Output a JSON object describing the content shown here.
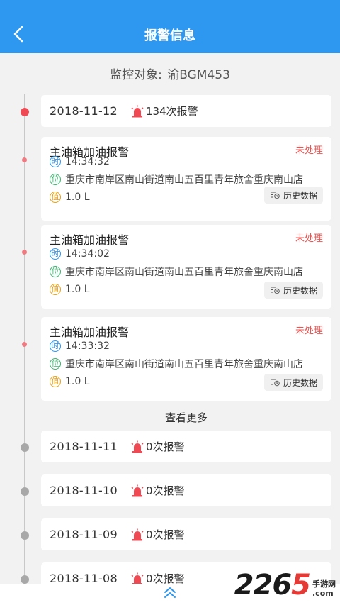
{
  "header": {
    "title": "报警信息"
  },
  "subject": {
    "label": "监控对象:",
    "plate": "渝BGM453"
  },
  "days": [
    {
      "date": "2018-11-12",
      "count": "134次报警"
    },
    {
      "date": "2018-11-11",
      "count": "0次报警"
    },
    {
      "date": "2018-11-10",
      "count": "0次报警"
    },
    {
      "date": "2018-11-09",
      "count": "0次报警"
    },
    {
      "date": "2018-11-08",
      "count": "0次报警"
    }
  ],
  "alarms": [
    {
      "title": "主油箱加油报警",
      "status": "未处理",
      "time": "14:34:32",
      "address": "重庆市南岸区南山街道南山五百里青年旅舍重庆南山店",
      "value": "1.0 L"
    },
    {
      "title": "主油箱加油报警",
      "status": "未处理",
      "time": "14:34:02",
      "address": "重庆市南岸区南山街道南山五百里青年旅舍重庆南山店",
      "value": "1.0 L"
    },
    {
      "title": "主油箱加油报警",
      "status": "未处理",
      "time": "14:33:32",
      "address": "重庆市南岸区南山街道南山五百里青年旅舍重庆南山店",
      "value": "1.0 L"
    }
  ],
  "badges": {
    "time": "时",
    "position": "位",
    "value": "值"
  },
  "history_label": "历史数据",
  "more_label": "查看更多",
  "watermark": {
    "num_a": "22",
    "num_b": "6",
    "num_c": "5",
    "line1": "手游网",
    "line2": ".com"
  },
  "colors": {
    "primary": "#2e97f0",
    "alert": "#ef4a54",
    "status": "#ef5350"
  }
}
